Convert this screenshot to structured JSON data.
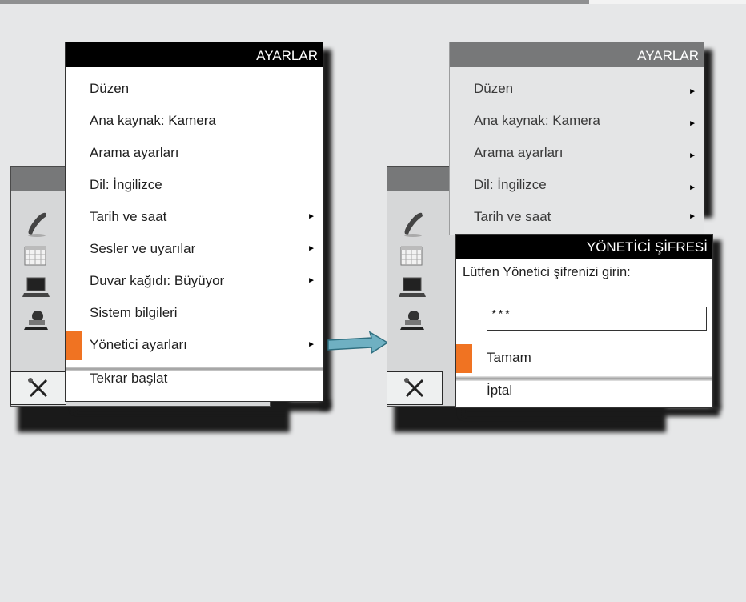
{
  "left": {
    "title": "AYARLAR",
    "items": [
      {
        "label": "Düzen",
        "arrow": false
      },
      {
        "label": "Ana kaynak: Kamera",
        "arrow": false
      },
      {
        "label": "Arama ayarları",
        "arrow": false
      },
      {
        "label": "Dil: İngilizce",
        "arrow": false
      },
      {
        "label": "Tarih ve saat",
        "arrow": true
      },
      {
        "label": "Sesler ve uyarılar",
        "arrow": true
      },
      {
        "label": "Duvar kağıdı: Büyüyor",
        "arrow": true
      },
      {
        "label": "Sistem bilgileri",
        "arrow": false
      },
      {
        "label": "Yönetici ayarları",
        "arrow": true,
        "selected": true
      },
      {
        "label": "Tekrar başlat",
        "arrow": false
      }
    ]
  },
  "right": {
    "title": "AYARLAR",
    "items": [
      {
        "label": "Düzen",
        "arrow": true
      },
      {
        "label": "Ana kaynak: Kamera",
        "arrow": true
      },
      {
        "label": "Arama ayarları",
        "arrow": true
      },
      {
        "label": "Dil: İngilizce",
        "arrow": true
      },
      {
        "label": "Tarih ve saat",
        "arrow": true
      }
    ]
  },
  "dialog": {
    "title": "YÖNETİCİ ŞİFRESİ",
    "prompt": "Lütfen Yönetici şifrenizi girin:",
    "password_value": "***",
    "ok_label": "Tamam",
    "cancel_label": "İptal"
  },
  "arrow_glyph": "►",
  "icons": [
    "phone-icon",
    "calendar-icon",
    "laptop-icon",
    "camera-icon",
    "tools-icon"
  ],
  "colors": {
    "accent": "#f07322",
    "title_bar": "#000000",
    "background": "#e6e7e8"
  }
}
